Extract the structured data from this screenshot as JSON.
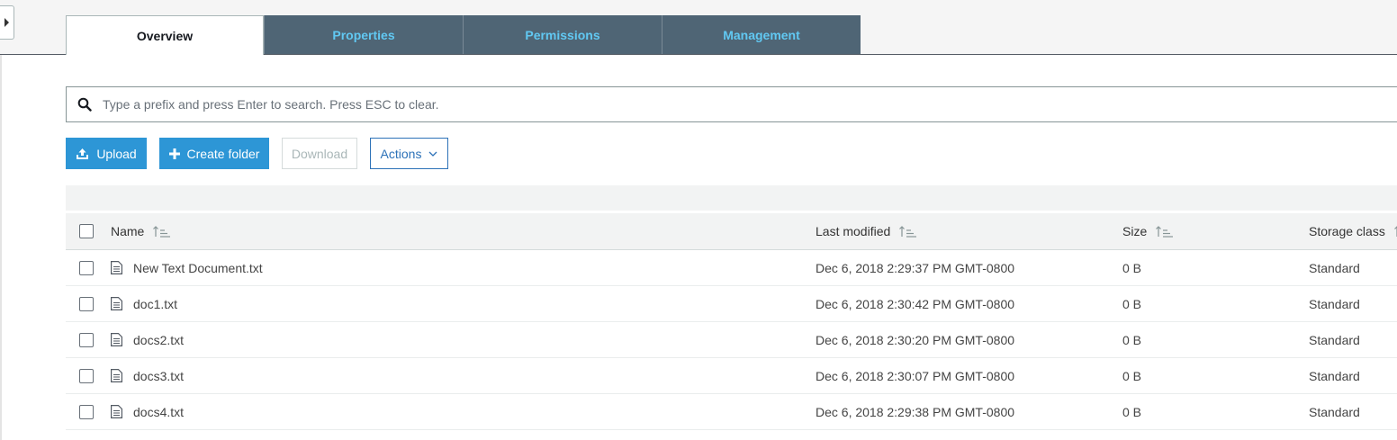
{
  "tabs": [
    {
      "label": "Overview",
      "active": true
    },
    {
      "label": "Properties",
      "active": false
    },
    {
      "label": "Permissions",
      "active": false
    },
    {
      "label": "Management",
      "active": false
    }
  ],
  "search": {
    "placeholder": "Type a prefix and press Enter to search. Press ESC to clear.",
    "icon": "search-icon"
  },
  "toolbar": {
    "upload_label": "Upload",
    "create_folder_label": "Create folder",
    "download_label": "Download",
    "actions_label": "Actions"
  },
  "table": {
    "columns": {
      "name": "Name",
      "last_modified": "Last modified",
      "size": "Size",
      "storage_class": "Storage class"
    },
    "rows": [
      {
        "name": "New Text Document.txt",
        "last_modified": "Dec 6, 2018 2:29:37 PM GMT-0800",
        "size": "0 B",
        "storage_class": "Standard"
      },
      {
        "name": "doc1.txt",
        "last_modified": "Dec 6, 2018 2:30:42 PM GMT-0800",
        "size": "0 B",
        "storage_class": "Standard"
      },
      {
        "name": "docs2.txt",
        "last_modified": "Dec 6, 2018 2:30:20 PM GMT-0800",
        "size": "0 B",
        "storage_class": "Standard"
      },
      {
        "name": "docs3.txt",
        "last_modified": "Dec 6, 2018 2:30:07 PM GMT-0800",
        "size": "0 B",
        "storage_class": "Standard"
      },
      {
        "name": "docs4.txt",
        "last_modified": "Dec 6, 2018 2:29:38 PM GMT-0800",
        "size": "0 B",
        "storage_class": "Standard"
      }
    ]
  },
  "colors": {
    "primary_button": "#2d96d6",
    "tab_inactive_bg": "#4f6575",
    "tab_inactive_text": "#61c8f2",
    "link_blue": "#2d72b8"
  }
}
